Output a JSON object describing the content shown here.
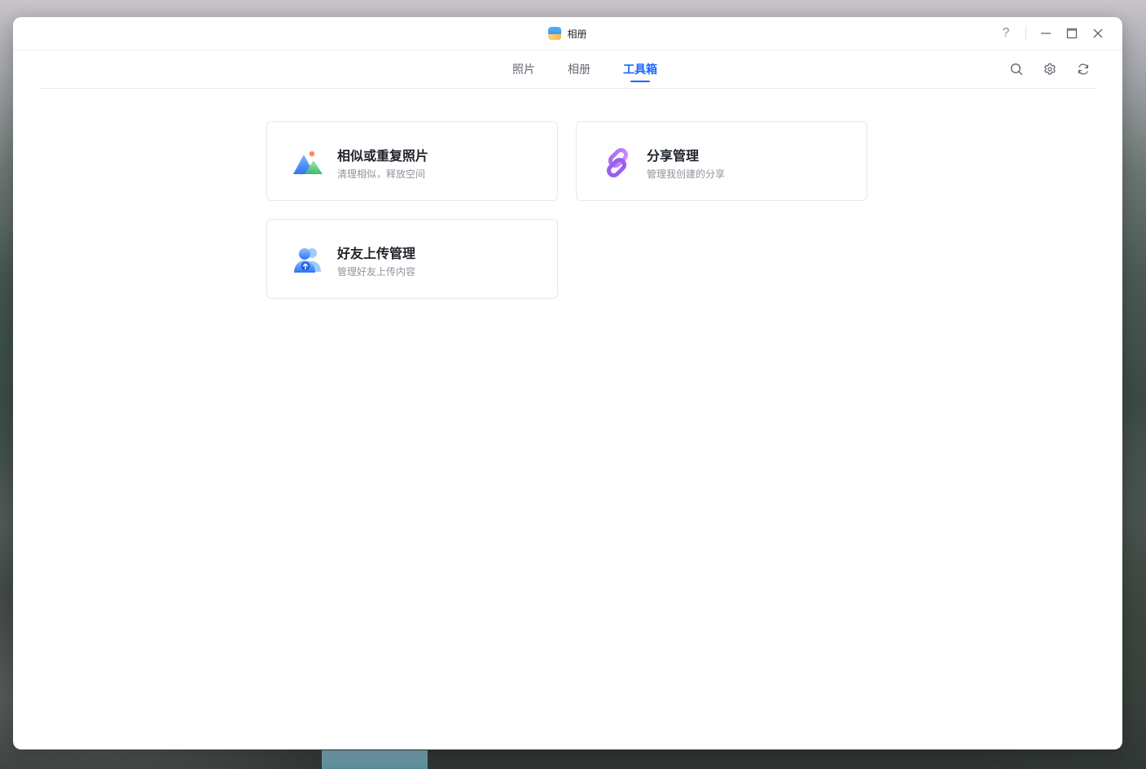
{
  "window": {
    "title": "相册",
    "controls": {
      "help": "?",
      "help_icon": "help-icon",
      "minimize_icon": "minimize-icon",
      "maximize_icon": "maximize-icon",
      "close_icon": "close-icon"
    }
  },
  "tabs": [
    {
      "label": "照片",
      "active": false
    },
    {
      "label": "相册",
      "active": false
    },
    {
      "label": "工具箱",
      "active": true
    }
  ],
  "toolbar": {
    "icons": [
      "search-icon",
      "settings-icon",
      "refresh-icon"
    ]
  },
  "colors": {
    "accent": "#1a66ff",
    "text_primary": "#1f2329",
    "text_secondary": "#8f959e",
    "card_border": "#e6e8eb"
  },
  "tools": [
    {
      "title": "相似或重复照片",
      "desc": "清理相似，释放空间",
      "icon": "similar-photos-icon"
    },
    {
      "title": "分享管理",
      "desc": "管理我创建的分享",
      "icon": "link-icon"
    },
    {
      "title": "好友上传管理",
      "desc": "管理好友上传内容",
      "icon": "friend-upload-icon"
    }
  ]
}
